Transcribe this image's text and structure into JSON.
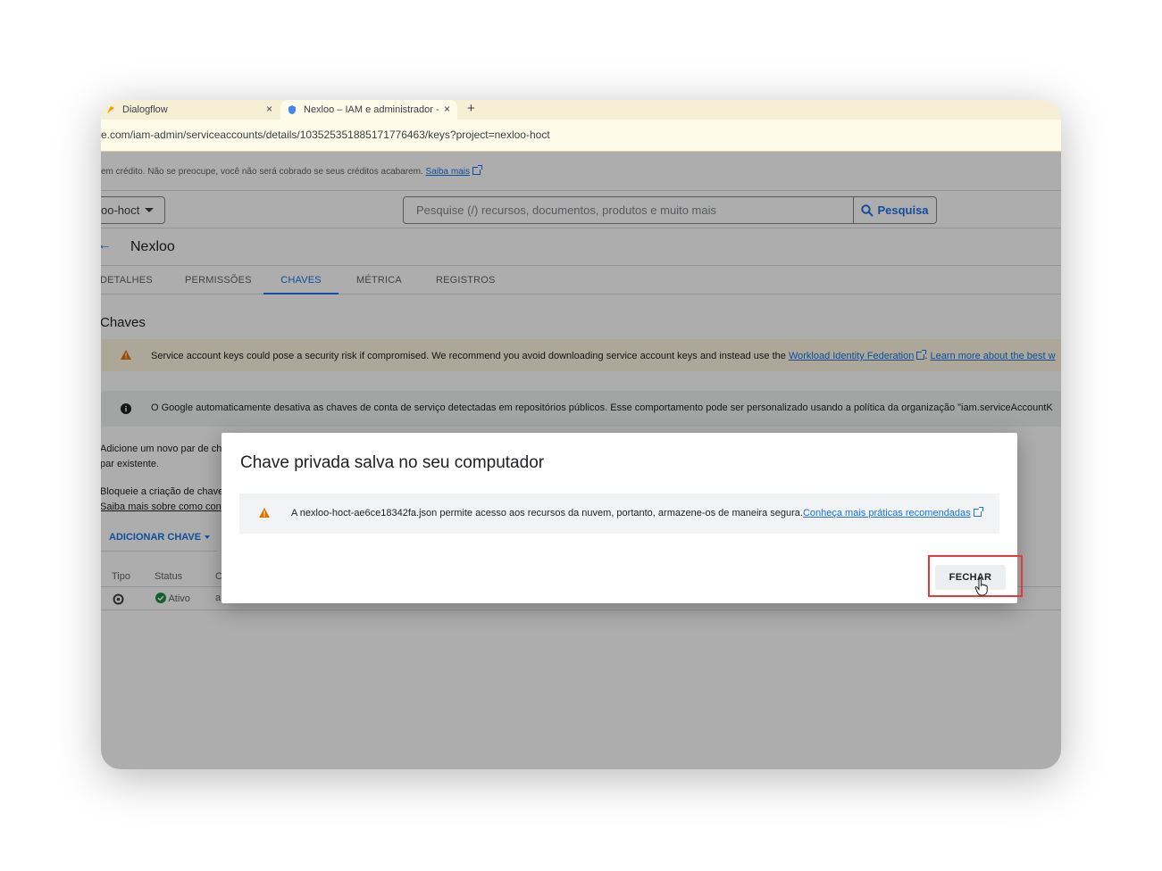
{
  "browser": {
    "tabs": [
      {
        "label": "Dialogflow",
        "close": "×"
      },
      {
        "label": "Nexloo – IAM e administrador -",
        "close": "×"
      }
    ],
    "new_tab": "+",
    "url": "e.com/iam-admin/serviceaccounts/details/103525351885171776463/keys?project=nexloo-hoct"
  },
  "credit_bar": {
    "text": "em crédito. Não se preocupe, você não será cobrado se seus créditos acabarem.",
    "link": "Saiba mais"
  },
  "topbar": {
    "project": "oo-hoct",
    "search_placeholder": "Pesquise (/) recursos, documentos, produtos e muito mais",
    "search_button": "Pesquisa"
  },
  "page": {
    "title": "Nexloo",
    "tabs": [
      "DETALHES",
      "PERMISSÕES",
      "CHAVES",
      "MÉTRICA",
      "REGISTROS"
    ],
    "active_tab": "CHAVES",
    "section_title": "Chaves",
    "warning": {
      "text": "Service account keys could pose a security risk if compromised. We recommend you avoid downloading service account keys and instead use the",
      "link1": "Workload Identity Federation",
      "link2": "Learn more about the best w"
    },
    "info": {
      "text": "O Google automaticamente desativa as chaves de conta de serviço detectadas em repositórios públicos. Esse comportamento pode ser personalizado usando a política da organização \"iam.serviceAccountK"
    },
    "add_text_line1": "Adicione um novo par de ch",
    "add_text_line2": "par existente.",
    "block_text": "Bloqueie a criação de chave",
    "block_link": "Saiba mais sobre como con",
    "add_key_button": "ADICIONAR CHAVE",
    "table": {
      "headers": [
        "Tipo",
        "Status",
        "C"
      ],
      "row": {
        "status": "Ativo",
        "c": "a"
      }
    }
  },
  "dialog": {
    "title": "Chave privada salva no seu computador",
    "message": "A nexloo-hoct-ae6ce18342fa.json permite acesso aos recursos da nuvem, portanto, armazene-os de maneira segura.",
    "link": "Conheça mais práticas recomendadas",
    "close_button": "FECHAR"
  },
  "colors": {
    "accent": "#1a73e8",
    "warning": "#e37400",
    "highlight_box": "#e53935",
    "success": "#1e8e3e"
  }
}
